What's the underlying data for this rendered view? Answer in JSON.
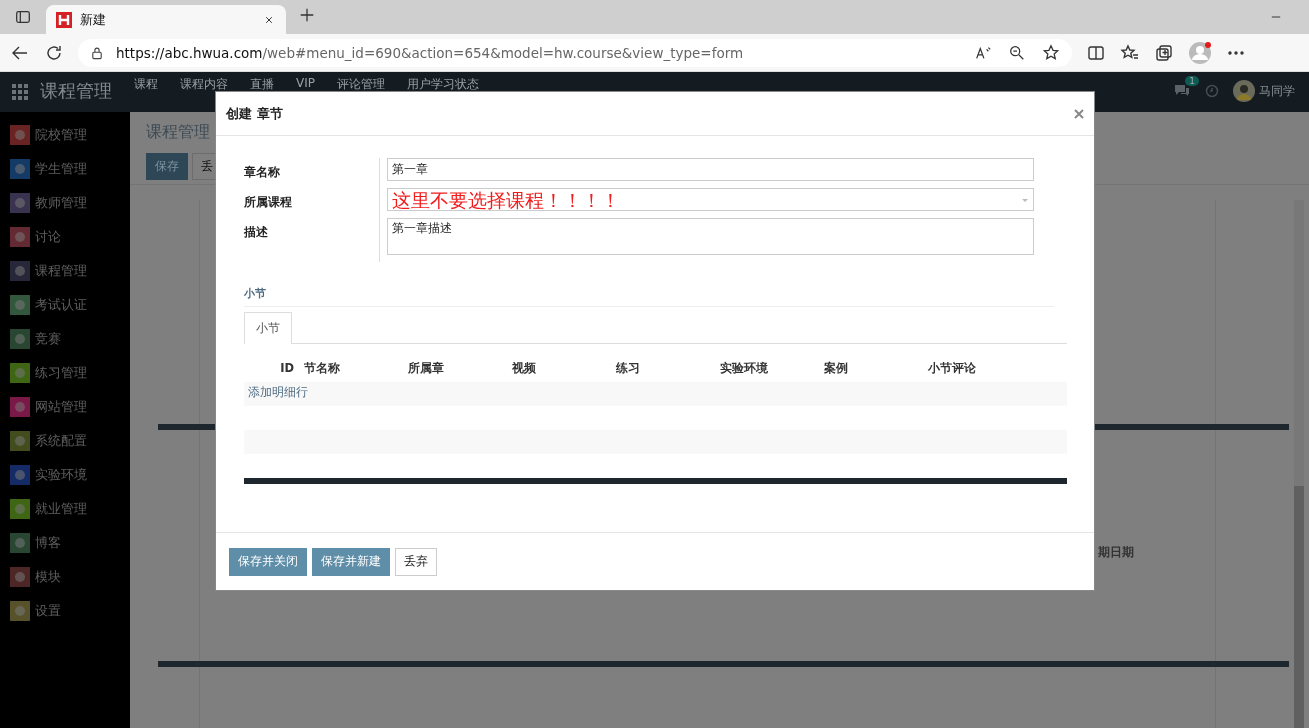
{
  "browser": {
    "tab": {
      "title": "新建"
    },
    "url": {
      "host": "https://abc.hwua.com",
      "path": "/web#menu_id=690&action=654&model=hw.course&view_type=form"
    }
  },
  "app": {
    "title": "课程管理",
    "menu": [
      "课程",
      "课程内容",
      "直播",
      "VIP",
      "评论管理",
      "用户学习状态"
    ],
    "notification_count": "1",
    "user": "马同学"
  },
  "sidebar": {
    "items": [
      {
        "label": "院校管理",
        "color": "#6a2323"
      },
      {
        "label": "学生管理",
        "color": "#143a66"
      },
      {
        "label": "教师管理",
        "color": "#3a3350"
      },
      {
        "label": "讨论",
        "color": "#642a33"
      },
      {
        "label": "课程管理",
        "color": "#27273a"
      },
      {
        "label": "考试认证",
        "color": "#33573d"
      },
      {
        "label": "竞赛",
        "color": "#284632"
      },
      {
        "label": "练习管理",
        "color": "#3f6614"
      },
      {
        "label": "网站管理",
        "color": "#7a1848"
      },
      {
        "label": "系统配置",
        "color": "#434c1c"
      },
      {
        "label": "实验环境",
        "color": "#152b66"
      },
      {
        "label": "就业管理",
        "color": "#3f6614"
      },
      {
        "label": "博客",
        "color": "#284632"
      },
      {
        "label": "模块",
        "color": "#4d2626"
      },
      {
        "label": "设置",
        "color": "#58522a"
      }
    ]
  },
  "page": {
    "breadcrumb": "课程管理",
    "buttons": [
      {
        "label": "保存",
        "kind": "primary"
      },
      {
        "label": "丢",
        "kind": "default"
      }
    ],
    "column_label": "期日期"
  },
  "dialog": {
    "title": "创建 章节",
    "fields": [
      {
        "label": "章名称",
        "kind": "text",
        "value": "第一章"
      },
      {
        "label": "所属课程",
        "kind": "select",
        "value": "这里不要选择课程！！！！"
      },
      {
        "label": "描述",
        "kind": "textarea",
        "value": "第一章描述"
      }
    ],
    "section": "小节",
    "tabs": [
      {
        "label": "小节",
        "selected": true
      }
    ],
    "table": {
      "columns": [
        "ID",
        "节名称",
        "所属章",
        "视频",
        "练习",
        "实验环境",
        "案例",
        "小节评论"
      ],
      "add_line": "添加明细行"
    },
    "buttons": [
      {
        "label": "保存并关闭",
        "kind": "primary"
      },
      {
        "label": "保存并新建",
        "kind": "primary"
      },
      {
        "label": "丢弃",
        "kind": "default"
      }
    ]
  }
}
